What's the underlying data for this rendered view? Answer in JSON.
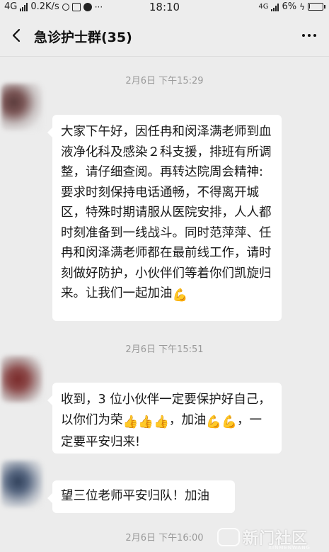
{
  "status_bar": {
    "network": "4G",
    "speed": "0.2K/s",
    "time": "18:10",
    "network_right": "4G",
    "battery_percent": "6%",
    "battery_level": 0.06
  },
  "header": {
    "title": "急诊护士群(35)",
    "back_icon": "chevron-left-icon",
    "more_icon": "more-dots-icon"
  },
  "messages": [
    {
      "timestamp": "2月6日 下午15:29",
      "text": "大家下午好，因任冉和闵泽满老师到血液净化科及感染２科支援，排班有所调整，请仔细查阅。再转达院周会精神:要求时刻保持电话通畅，不得离开城区，特殊时期请服从医院安排，人人都时刻准备到一线战斗。同时范萍萍、任冉和闵泽满老师都在最前线工作，请时刻做好防护，小伙伴们等着你们凯旋归来。让我们一起加油",
      "emoji": "💪"
    },
    {
      "timestamp": "2月6日 下午15:51",
      "text_part1": "收到，3 位小伙伴一定要保护好自己，以你们为荣",
      "text_part2": "，加油",
      "text_part3": "，一定要平安归来!",
      "emoji_thumbs": "👍",
      "emoji_muscle": "💪"
    },
    {
      "text": "望三位老师平安归队！加油"
    },
    {
      "timestamp": "2月6日 下午16:00"
    }
  ],
  "watermark": {
    "text": "新门社区",
    "sub": "XINMENWANG"
  }
}
